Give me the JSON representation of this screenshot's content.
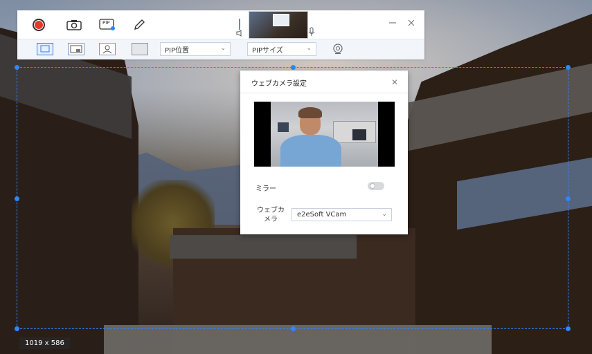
{
  "toolbar": {
    "position_dropdown": {
      "label": "PIP位置"
    },
    "size_dropdown": {
      "label": "PIPサイズ"
    },
    "pip_badge": "PIP"
  },
  "selection": {
    "size_label": "1019 x 586"
  },
  "dialog": {
    "title": "ウェブカメラ設定",
    "mirror_label": "ミラー",
    "mirror_enabled": false,
    "webcam_label": "ウェブカメラ",
    "webcam_selected": "e2eSoft VCam"
  },
  "icons": [
    "record-icon",
    "camera-icon",
    "pip-icon",
    "pencil-icon",
    "speaker-icon",
    "mic-icon",
    "minimize-icon",
    "close-icon",
    "layout-full-icon",
    "layout-pip-right-icon",
    "layout-person-icon",
    "layout-blank-icon",
    "webcam-icon",
    "dialog-close-icon",
    "chevron-down-icon"
  ],
  "colors": {
    "accent": "#2f86ff",
    "record": "#e8382c"
  }
}
